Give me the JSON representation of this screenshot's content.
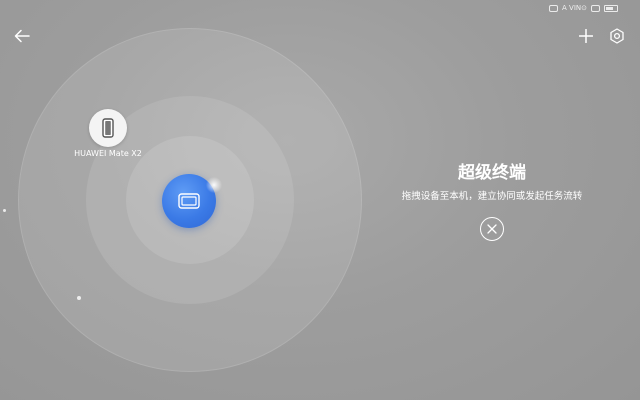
{
  "status_bar": {
    "text": "A VIN⊙"
  },
  "header": {
    "back_icon": "arrow-left-icon",
    "add_icon": "plus-icon",
    "settings_icon": "gear-icon"
  },
  "radar": {
    "nearby_device": {
      "label": "HUAWEI Mate X2",
      "icon": "phone-icon"
    },
    "this_device": {
      "icon": "tablet-icon"
    }
  },
  "panel": {
    "title": "超级终端",
    "subtitle": "拖拽设备至本机，建立协同或发起任务流转",
    "close_icon": "close-icon"
  },
  "colors": {
    "background": "#9d9d9d",
    "accent_blue": "#3b7ae6",
    "foreground": "#ffffff"
  }
}
